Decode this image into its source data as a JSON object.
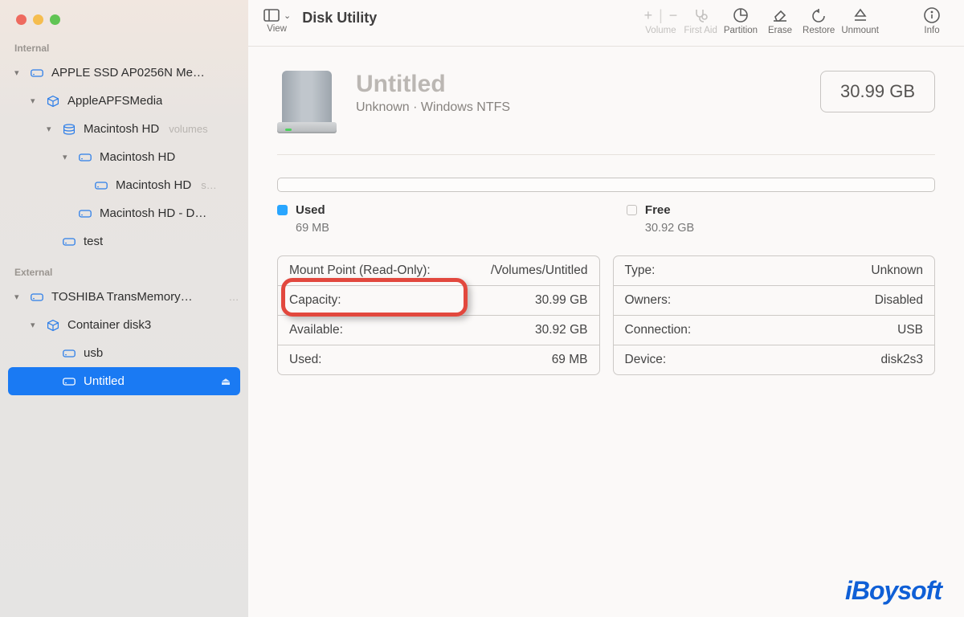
{
  "window": {
    "title": "Disk Utility"
  },
  "traffic": {
    "close_color": "#ee6a5f",
    "min_color": "#f5bd4f",
    "max_color": "#61c454"
  },
  "toolbar": {
    "view_label": "View",
    "volume_label": "Volume",
    "firstaid_label": "First Aid",
    "partition_label": "Partition",
    "erase_label": "Erase",
    "restore_label": "Restore",
    "unmount_label": "Unmount",
    "info_label": "Info",
    "plus": "+",
    "minus": "−"
  },
  "sidebar": {
    "internal_label": "Internal",
    "external_label": "External",
    "internal": [
      {
        "label": "APPLE SSD AP0256N Me…",
        "icon": "hdd",
        "indent": 0,
        "chev": true
      },
      {
        "label": "AppleAPFSMedia",
        "icon": "cube",
        "indent": 1,
        "chev": true
      },
      {
        "label": "Macintosh HD",
        "icon": "stack",
        "indent": 2,
        "chev": true,
        "sub": "volumes"
      },
      {
        "label": "Macintosh HD",
        "icon": "hdd",
        "indent": 3,
        "chev": true
      },
      {
        "label": "Macintosh HD",
        "icon": "hdd",
        "indent": 4,
        "sub": "s…"
      },
      {
        "label": "Macintosh HD - D…",
        "icon": "hdd",
        "indent": 3
      },
      {
        "label": "test",
        "icon": "hdd",
        "indent": 2
      }
    ],
    "external": [
      {
        "label": "TOSHIBA TransMemory…",
        "icon": "hdd",
        "indent": 0,
        "chev": true,
        "trail": "…"
      },
      {
        "label": "Container disk3",
        "icon": "cube",
        "indent": 1,
        "chev": true
      },
      {
        "label": "usb",
        "icon": "hdd",
        "indent": 2
      },
      {
        "label": "Untitled",
        "icon": "hdd",
        "indent": 2,
        "selected": true,
        "trail": "⏏"
      }
    ]
  },
  "volume": {
    "name": "Untitled",
    "meta": "Unknown · Windows NTFS",
    "capacity_badge": "30.99 GB",
    "used_label": "Used",
    "used_value": "69 MB",
    "free_label": "Free",
    "free_value": "30.92 GB"
  },
  "info_left": [
    {
      "k": "Mount Point (Read-Only):",
      "v": "/Volumes/Untitled"
    },
    {
      "k": "Capacity:",
      "v": "30.99 GB"
    },
    {
      "k": "Available:",
      "v": "30.92 GB"
    },
    {
      "k": "Used:",
      "v": "69 MB"
    }
  ],
  "info_right": [
    {
      "k": "Type:",
      "v": "Unknown"
    },
    {
      "k": "Owners:",
      "v": "Disabled"
    },
    {
      "k": "Connection:",
      "v": "USB"
    },
    {
      "k": "Device:",
      "v": "disk2s3"
    }
  ],
  "brand": "iBoysoft"
}
